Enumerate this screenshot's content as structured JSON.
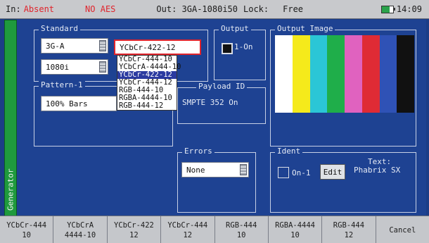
{
  "status": {
    "in_label": "In:",
    "in_value": "Absent",
    "aes": "NO AES",
    "out": "Out: 3GA-1080i50",
    "lock_label": "Lock:",
    "lock_value": "Free",
    "time": "14:09",
    "alert_color": "#e0242c"
  },
  "sidetab": {
    "label": "Generator",
    "color": "#1f9a3d"
  },
  "standard": {
    "title": "Standard",
    "rate_value": "3G-A",
    "format_value": "1080i",
    "sampling_value": "YCbCr-422-12",
    "sampling_options": [
      "YCbCr-444-10",
      "YCbCrA-4444-10",
      "YCbCr-422-12",
      "YCbCr-444-12",
      "RGB-444-10",
      "RGBA-4444-10",
      "RGB-444-12"
    ],
    "sampling_highlighted": "YCbCr-422-12"
  },
  "output": {
    "title": "Output",
    "checkbox_label": "1-On",
    "checked": true
  },
  "output_image": {
    "title": "Output Image",
    "bar_colors": [
      "#ffffff",
      "#f5ea1b",
      "#2bc6d6",
      "#1fae4a",
      "#e062bf",
      "#df2b35",
      "#2f52b6",
      "#111111"
    ]
  },
  "pattern": {
    "title": "Pattern-1",
    "value": "100% Bars"
  },
  "payload": {
    "title": "Payload ID",
    "value": "SMPTE 352 On"
  },
  "errors": {
    "title": "Errors",
    "value": "None"
  },
  "ident": {
    "title": "Ident",
    "checkbox_label": "On-1",
    "edit_label": "Edit",
    "text_label": "Text:",
    "text_value": "Phabrix SX"
  },
  "softkeys": [
    {
      "line1": "YCbCr-444",
      "line2": "10"
    },
    {
      "line1": "YCbCrA",
      "line2": "4444-10"
    },
    {
      "line1": "YCbCr-422",
      "line2": "12"
    },
    {
      "line1": "YCbCr-444",
      "line2": "12"
    },
    {
      "line1": "RGB-444",
      "line2": "10"
    },
    {
      "line1": "RGBA-4444",
      "line2": "10"
    },
    {
      "line1": "RGB-444",
      "line2": "12"
    },
    {
      "line1": "Cancel",
      "line2": ""
    }
  ]
}
